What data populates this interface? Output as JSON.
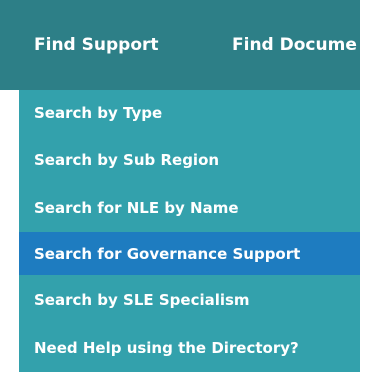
{
  "nav": {
    "tabs": [
      {
        "label": "Find Support"
      },
      {
        "label": "Find Docume"
      }
    ]
  },
  "menu": {
    "items": [
      {
        "label": "Search by Type"
      },
      {
        "label": "Search by Sub Region"
      },
      {
        "label": "Search for NLE by Name"
      },
      {
        "label": "Search for Governance Support",
        "active": true
      },
      {
        "label": "Search by SLE Specialism"
      },
      {
        "label": "Need Help using the Directory?"
      }
    ]
  },
  "colors": {
    "topbar": "#2d7f87",
    "menu_bg": "#33a1ac",
    "active_item": "#1e7cc0",
    "text": "#ffffff"
  }
}
